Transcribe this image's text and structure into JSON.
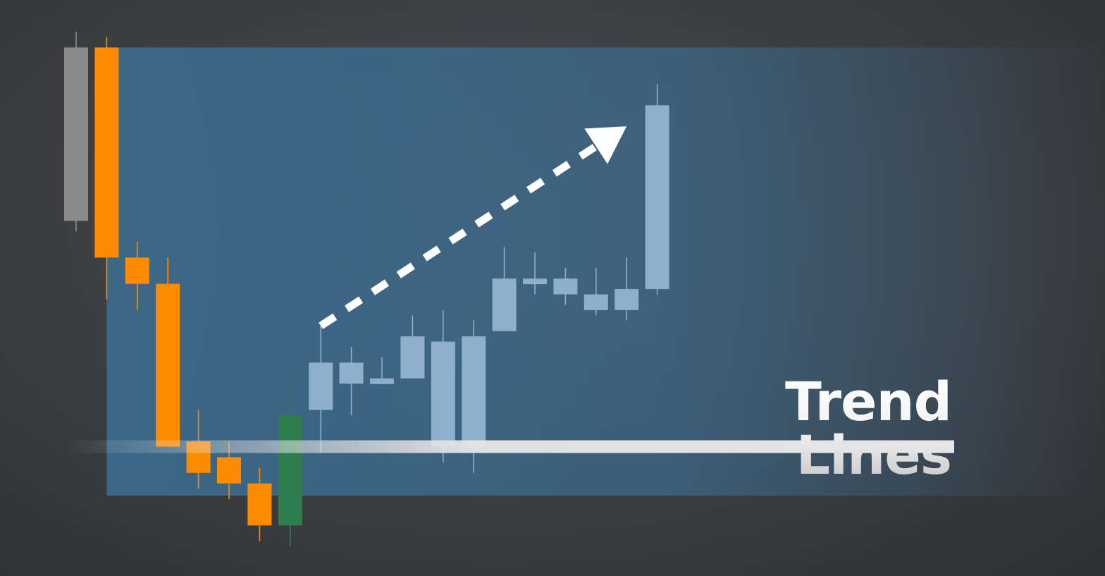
{
  "chart_data": {
    "type": "candlestick",
    "title": "Trend Lines",
    "ylim": [
      0,
      100
    ],
    "grid": false,
    "colors": {
      "neutral": "#8a8a8a",
      "bearish": "#ff8c00",
      "bullish": "#2e7d4f",
      "projected": "#8fb0cc",
      "highlight_zone": "#3c6a8c",
      "support_line": "#e6e6e6",
      "arrow": "#ffffff"
    },
    "series": [
      {
        "name": "",
        "candles": [
          {
            "open": 97,
            "close": 64,
            "high": 100,
            "low": 62,
            "role": "neutral"
          },
          {
            "open": 97,
            "close": 57,
            "high": 99,
            "low": 49,
            "role": "bearish"
          },
          {
            "open": 57,
            "close": 52,
            "high": 60,
            "low": 47,
            "role": "bearish"
          },
          {
            "open": 52,
            "close": 21,
            "high": 57,
            "low": 21,
            "role": "bearish"
          },
          {
            "open": 22,
            "close": 16,
            "high": 28,
            "low": 13,
            "role": "bearish"
          },
          {
            "open": 19,
            "close": 14,
            "high": 22,
            "low": 11,
            "role": "bearish"
          },
          {
            "open": 14,
            "close": 6,
            "high": 17,
            "low": 3,
            "role": "bearish"
          },
          {
            "open": 6,
            "close": 27,
            "high": 34,
            "low": 2,
            "role": "bullish"
          },
          {
            "open": 28,
            "close": 37,
            "high": 44,
            "low": 20,
            "role": "projected"
          },
          {
            "open": 33,
            "close": 37,
            "high": 40,
            "low": 27,
            "role": "projected"
          },
          {
            "open": 33,
            "close": 34,
            "high": 38,
            "low": 33,
            "role": "projected"
          },
          {
            "open": 34,
            "close": 42,
            "high": 46,
            "low": 34,
            "role": "projected"
          },
          {
            "open": 21,
            "close": 41,
            "high": 47,
            "low": 18,
            "role": "projected"
          },
          {
            "open": 21,
            "close": 42,
            "high": 45,
            "low": 16,
            "role": "projected"
          },
          {
            "open": 43,
            "close": 53,
            "high": 59,
            "low": 43,
            "role": "projected"
          },
          {
            "open": 52,
            "close": 53,
            "high": 58,
            "low": 50,
            "role": "projected"
          },
          {
            "open": 50,
            "close": 53,
            "high": 55,
            "low": 48,
            "role": "projected"
          },
          {
            "open": 47,
            "close": 50,
            "high": 55,
            "low": 46,
            "role": "projected"
          },
          {
            "open": 47,
            "close": 51,
            "high": 57,
            "low": 45,
            "role": "projected"
          },
          {
            "open": 51,
            "close": 86,
            "high": 90,
            "low": 50,
            "role": "projected"
          }
        ]
      }
    ],
    "support_level": 21,
    "trend_arrow": {
      "from": {
        "index": 8,
        "value": 44
      },
      "to": {
        "index": 18,
        "value": 82
      }
    }
  }
}
